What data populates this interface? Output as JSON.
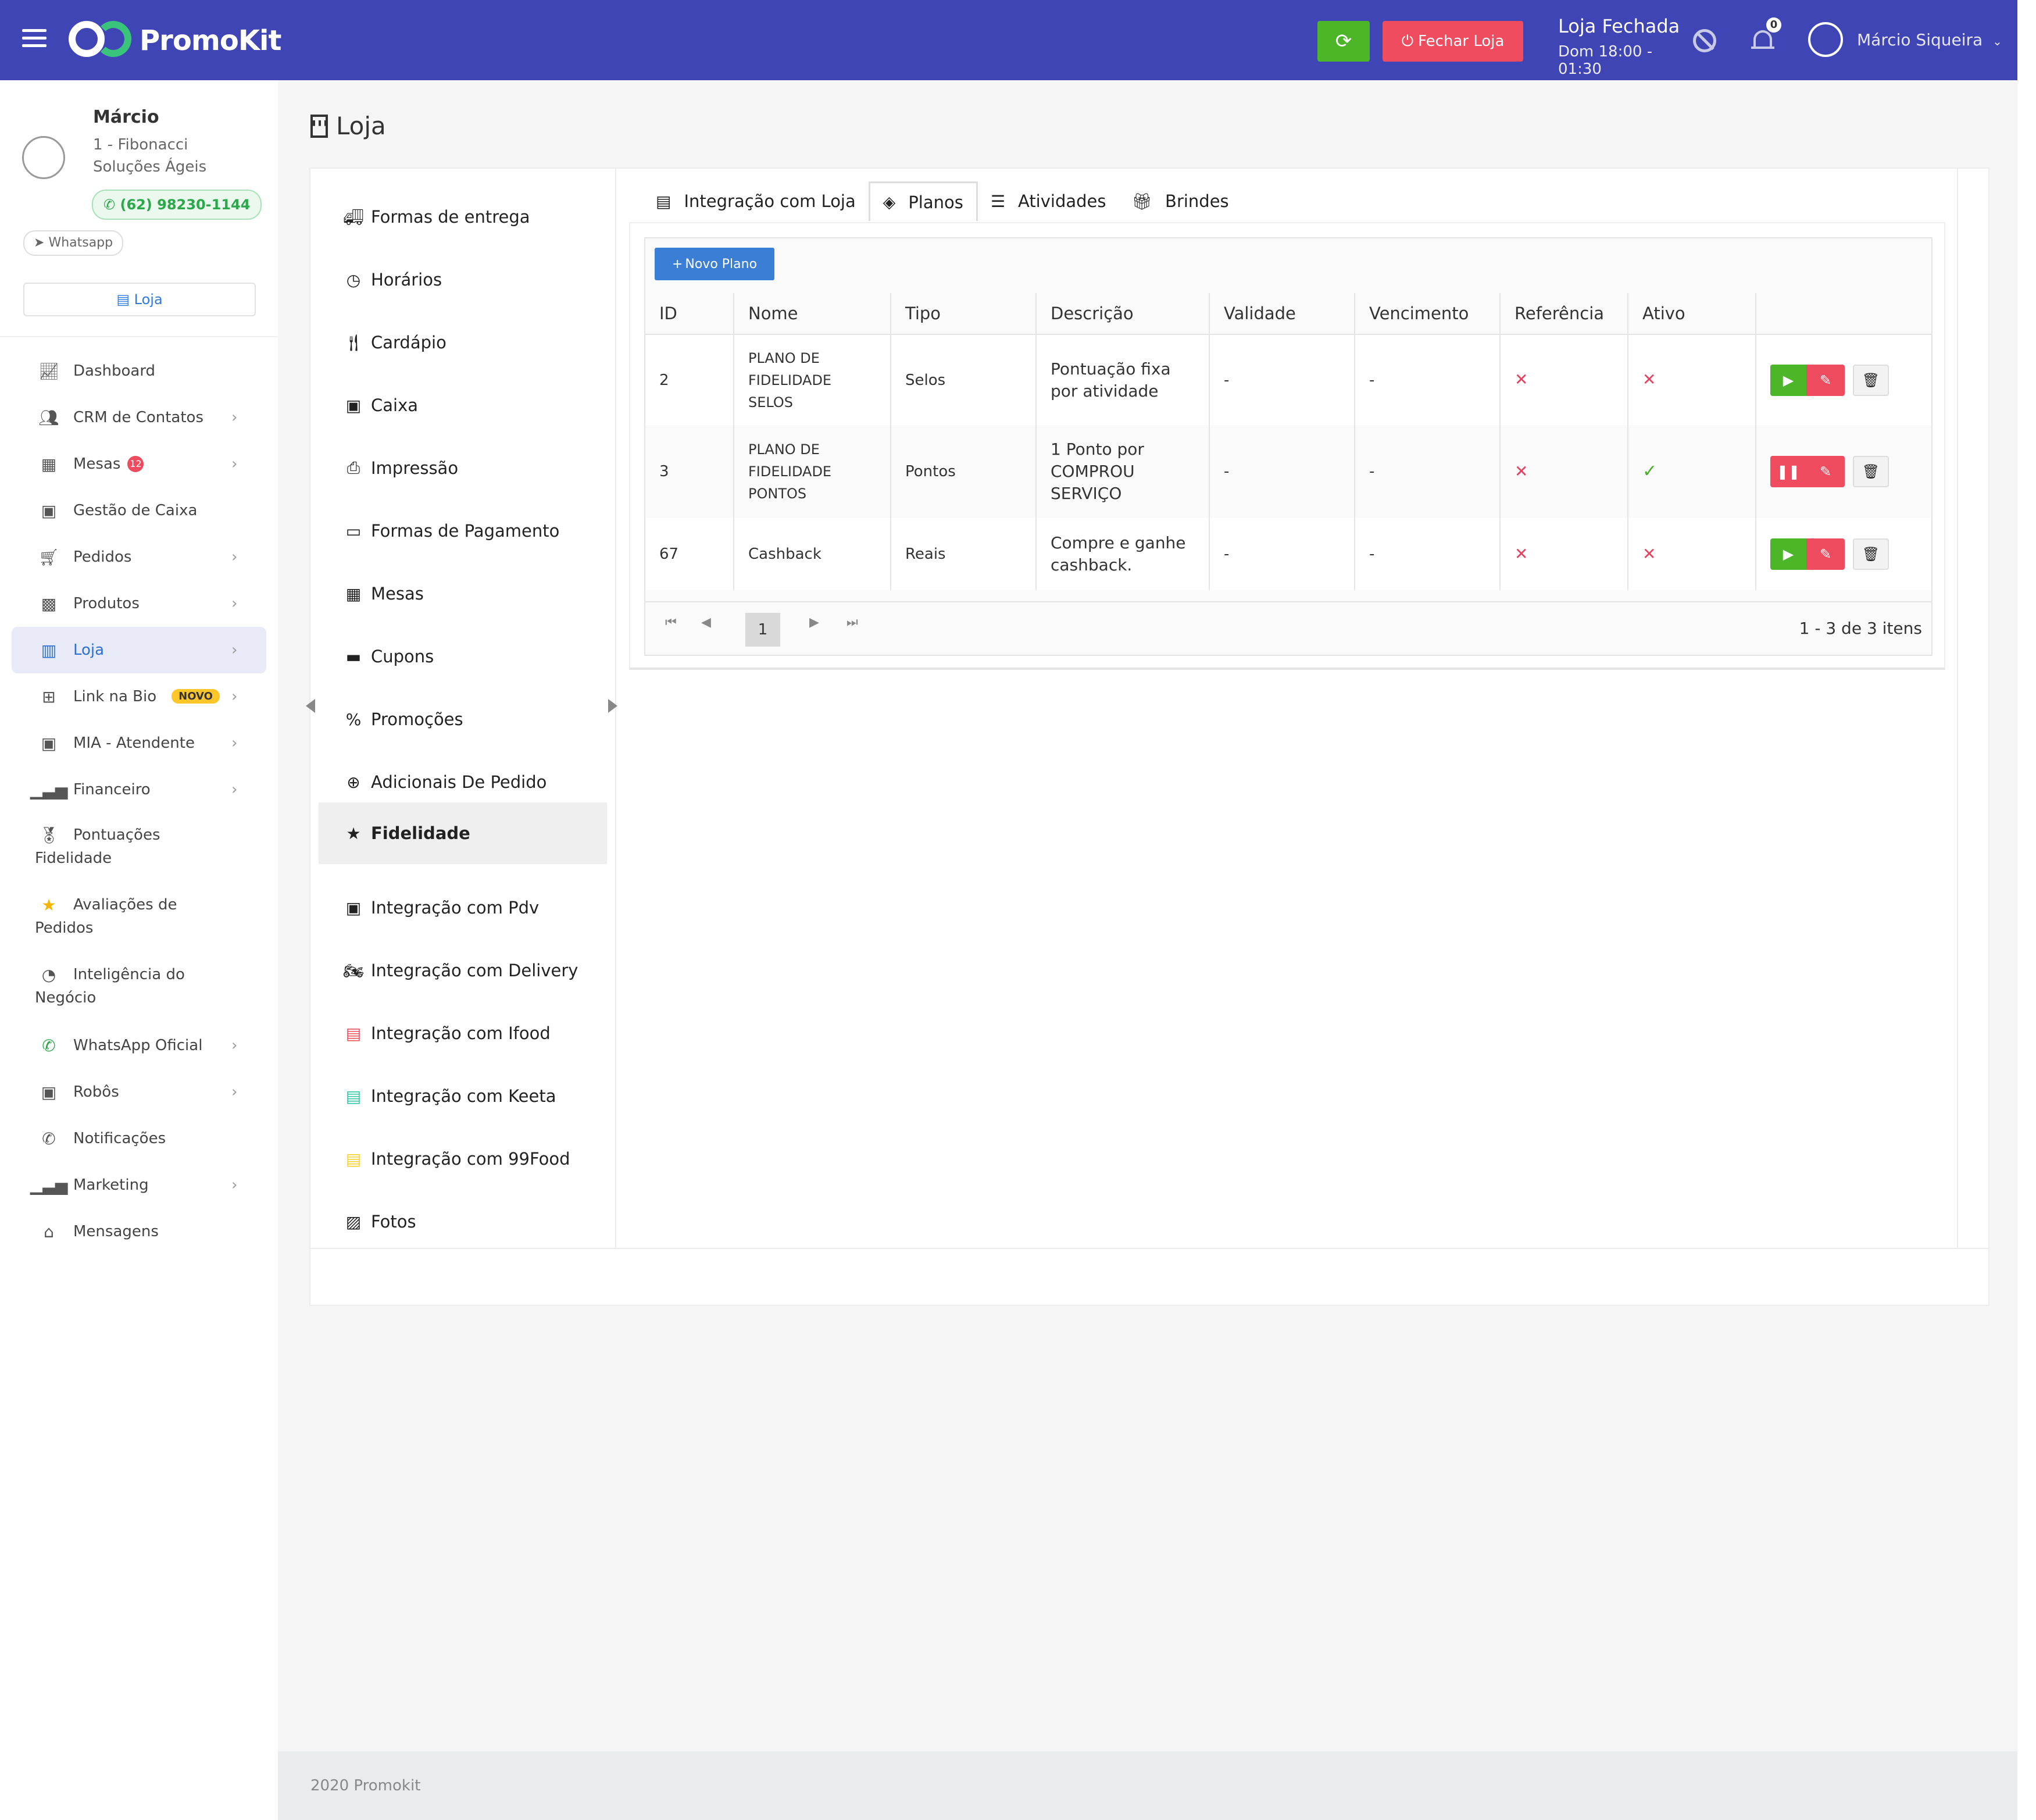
{
  "header": {
    "logo_text": "PromoKit",
    "refresh_icon": "refresh-icon",
    "close_store_label": "Fechar Loja",
    "store_status": "Loja Fechada",
    "store_hours": "Dom 18:00 - 01:30",
    "notification_count": "0",
    "user_name": "Márcio Siqueira",
    "colors": {
      "bar": "#3f45b5",
      "refresh": "#4db628",
      "close": "#ef4c5f"
    }
  },
  "profile": {
    "name": "Márcio",
    "company": "1 - Fibonacci Soluções Ágeis",
    "phone": "(62) 98230-1144",
    "whatsapp_label": "Whatsapp",
    "store_button": "Loja"
  },
  "sidebar": {
    "items": [
      {
        "label": "Dashboard",
        "icon": "chart-line-icon"
      },
      {
        "label": "CRM de Contatos",
        "icon": "users-icon",
        "chevron": "›"
      },
      {
        "label": "Mesas",
        "icon": "table-icon",
        "badge": "12",
        "chevron": "›"
      },
      {
        "label": "Gestão de Caixa",
        "icon": "cash-register-icon"
      },
      {
        "label": "Pedidos",
        "icon": "cart-icon",
        "chevron": "›"
      },
      {
        "label": "Produtos",
        "icon": "box-icon",
        "chevron": "›"
      },
      {
        "label": "Loja",
        "icon": "building-icon",
        "chevron": "›"
      },
      {
        "label": "Link na Bio",
        "icon": "sitemap-icon",
        "badge": "NOVO",
        "chevron": "›"
      },
      {
        "label": "MIA - Atendente",
        "icon": "robot-icon",
        "chevron": "›"
      },
      {
        "label": "Financeiro",
        "icon": "bar-chart-icon",
        "chevron": "›"
      },
      {
        "label": "Pontuações",
        "label2": "Fidelidade",
        "icon": "medal-icon"
      },
      {
        "label": "Avaliações de",
        "label2": "Pedidos",
        "icon": "star-icon"
      },
      {
        "label": "Inteligência do",
        "label2": "Negócio",
        "icon": "pie-chart-icon"
      },
      {
        "label": "WhatsApp Oficial",
        "icon": "whatsapp-icon",
        "chevron": "›"
      },
      {
        "label": "Robôs",
        "icon": "robot-icon",
        "chevron": "›"
      },
      {
        "label": "Notificações",
        "icon": "whatsapp-icon"
      },
      {
        "label": "Marketing",
        "icon": "bar-chart-icon",
        "chevron": "›"
      },
      {
        "label": "Mensagens",
        "icon": "inbox-icon"
      }
    ]
  },
  "page": {
    "title": "Loja"
  },
  "submenu": {
    "items": [
      {
        "label": "Formas de entrega",
        "icon": "truck-icon"
      },
      {
        "label": "Horários",
        "icon": "clock-icon"
      },
      {
        "label": "Cardápio",
        "icon": "utensils-icon"
      },
      {
        "label": "Caixa",
        "icon": "cash-register-icon"
      },
      {
        "label": "Impressão",
        "icon": "printer-icon"
      },
      {
        "label": "Formas de Pagamento",
        "icon": "credit-card-icon"
      },
      {
        "label": "Mesas",
        "icon": "table-icon"
      },
      {
        "label": "Cupons",
        "icon": "ticket-icon"
      },
      {
        "label": "Promoções",
        "icon": "percent-icon"
      },
      {
        "label": "Adicionais De Pedido",
        "icon": "plus-circle-icon"
      },
      {
        "label": "Fidelidade",
        "icon": "star-icon",
        "active": true
      },
      {
        "label": "Integração com Pdv",
        "icon": "cash-register-icon"
      },
      {
        "label": "Integração com Delivery",
        "icon": "motorcycle-icon"
      },
      {
        "label": "Integração com Ifood",
        "icon": "store-icon-red"
      },
      {
        "label": "Integração com Keeta",
        "icon": "store-icon-teal"
      },
      {
        "label": "Integração com 99Food",
        "icon": "store-icon-yellow"
      },
      {
        "label": "Fotos",
        "icon": "images-icon"
      }
    ]
  },
  "tabs": [
    {
      "label": "Integração com Loja",
      "icon": "store-icon"
    },
    {
      "label": "Planos",
      "icon": "layers-icon",
      "active": true
    },
    {
      "label": "Atividades",
      "icon": "list-icon"
    },
    {
      "label": "Brindes",
      "icon": "gift-icon"
    }
  ],
  "grid": {
    "new_button": "Novo Plano",
    "columns": [
      "ID",
      "Nome",
      "Tipo",
      "Descrição",
      "Validade",
      "Vencimento",
      "Referência",
      "Ativo",
      ""
    ],
    "rows": [
      {
        "id": "2",
        "nome": "PLANO DE FIDELIDADE SELOS",
        "tipo": "Selos",
        "descricao": "Pontuação fixa por atividade",
        "validade": "-",
        "vencimento": "-",
        "referencia": "✕",
        "ativo": "✕",
        "ativo_state": "no",
        "toggle": "play"
      },
      {
        "id": "3",
        "nome": "PLANO DE FIDELIDADE PONTOS",
        "tipo": "Pontos",
        "descricao": "1 Ponto por COMPROU SERVIÇO",
        "validade": "-",
        "vencimento": "-",
        "referencia": "✕",
        "ativo": "✓",
        "ativo_state": "yes",
        "toggle": "pause"
      },
      {
        "id": "67",
        "nome": "Cashback",
        "tipo": "Reais",
        "descricao": "Compre e ganhe cashback.",
        "validade": "-",
        "vencimento": "-",
        "referencia": "✕",
        "ativo": "✕",
        "ativo_state": "no",
        "toggle": "play"
      }
    ],
    "pager": {
      "current": "1",
      "info": "1 - 3 de 3 itens"
    }
  },
  "footer": {
    "text": "2020 Promokit"
  }
}
